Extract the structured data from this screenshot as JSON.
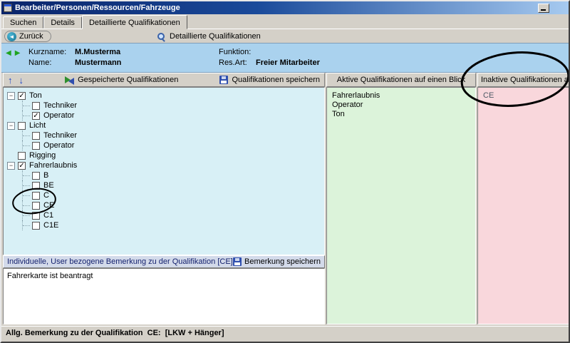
{
  "window": {
    "title": "Bearbeiter/Personen/Ressourcen/Fahrzeuge"
  },
  "tabs": {
    "suchen": "Suchen",
    "details": "Details",
    "detaillierte": "Detaillierte Qualifikationen"
  },
  "toolbar": {
    "back_label": "Zurück",
    "section_title": "Detaillierte Qualifikationen"
  },
  "person": {
    "kurzname_label": "Kurzname:",
    "kurzname_value": "M.Musterma",
    "name_label": "Name:",
    "name_value": "Mustermann",
    "funktion_label": "Funktion:",
    "funktion_value": "",
    "resart_label": "Res.Art:",
    "resart_value": "Freier Mitarbeiter"
  },
  "qual_toolbar": {
    "saved_button": "Gespeicherte Qualifikationen",
    "save_button": "Qualifikationen speichern"
  },
  "tree": {
    "items": [
      {
        "label": "Ton",
        "level": 0,
        "checked": true,
        "expander": true
      },
      {
        "label": "Techniker",
        "level": 1,
        "checked": false
      },
      {
        "label": "Operator",
        "level": 1,
        "checked": true
      },
      {
        "label": "Licht",
        "level": 0,
        "checked": false,
        "expander": true
      },
      {
        "label": "Techniker",
        "level": 1,
        "checked": false
      },
      {
        "label": "Operator",
        "level": 1,
        "checked": false
      },
      {
        "label": "Rigging",
        "level": 0,
        "checked": false,
        "expander": false
      },
      {
        "label": "Fahrerlaubnis",
        "level": 0,
        "checked": true,
        "expander": true
      },
      {
        "label": "B",
        "level": 1,
        "checked": false
      },
      {
        "label": "BE",
        "level": 1,
        "checked": false
      },
      {
        "label": "C",
        "level": 1,
        "checked": false
      },
      {
        "label": "CE",
        "level": 1,
        "checked": false,
        "annotated": true
      },
      {
        "label": "C1",
        "level": 1,
        "checked": false
      },
      {
        "label": "C1E",
        "level": 1,
        "checked": false
      }
    ]
  },
  "remark": {
    "header": "Individuelle, User bezogene Bemerkung zu der Qualifikation [CE]",
    "save_button": "Bemerkung speichern",
    "text": "Fahrerkarte ist beantragt"
  },
  "active_panel": {
    "header": "Aktive Qualifikationen auf einen Blick",
    "items": [
      "Fahrerlaubnis",
      "Operator",
      "Ton"
    ]
  },
  "inactive_panel": {
    "header": "Inaktive Qualifikationen au",
    "items": [
      "CE"
    ]
  },
  "statusbar": {
    "text": "Allg. Bemerkung zu der Qualifikation  CE:  [LKW + Hänger]"
  },
  "icons": {
    "minus": "−",
    "check": "✓",
    "up_arrow": "↑",
    "down_arrow": "↓",
    "prev_arrow": "◀",
    "next_arrow": "▶",
    "back_arrow": "◄"
  },
  "colors": {
    "titlebar_start": "#0a246a",
    "titlebar_end": "#a6caf0",
    "chrome": "#d4d0c8",
    "info_panel": "#aad2ee",
    "tree_panel": "#d8f0f6",
    "active_panel": "#dcf3da",
    "inactive_panel": "#f9d7dc"
  }
}
